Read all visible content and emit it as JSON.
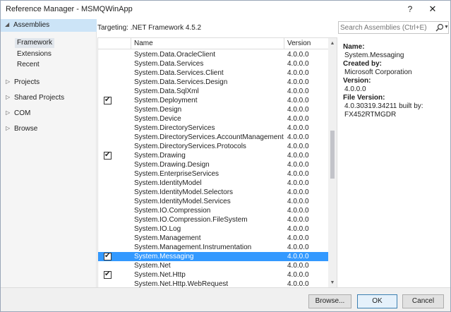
{
  "window": {
    "title": "Reference Manager - MSMQWinApp",
    "help_glyph": "?",
    "close_glyph": "✕"
  },
  "nav": {
    "header_label": "Assemblies",
    "header_arrow": "◢",
    "sub_items": [
      "Framework",
      "Extensions",
      "Recent"
    ],
    "groups": [
      {
        "label": "Projects",
        "arrow": "▷"
      },
      {
        "label": "Shared Projects",
        "arrow": "▷"
      },
      {
        "label": "COM",
        "arrow": "▷"
      },
      {
        "label": "Browse",
        "arrow": "▷"
      }
    ]
  },
  "targeting": {
    "text": "Targeting: .NET Framework 4.5.2"
  },
  "search": {
    "placeholder": "Search Assemblies (Ctrl+E)",
    "icon": "search-icon",
    "dropdown_glyph": "▼"
  },
  "grid": {
    "columns": [
      "Name",
      "Version"
    ],
    "rows": [
      {
        "name": "System.Data.OracleClient",
        "version": "4.0.0.0",
        "checked": false,
        "selected": false
      },
      {
        "name": "System.Data.Services",
        "version": "4.0.0.0",
        "checked": false,
        "selected": false
      },
      {
        "name": "System.Data.Services.Client",
        "version": "4.0.0.0",
        "checked": false,
        "selected": false
      },
      {
        "name": "System.Data.Services.Design",
        "version": "4.0.0.0",
        "checked": false,
        "selected": false
      },
      {
        "name": "System.Data.SqlXml",
        "version": "4.0.0.0",
        "checked": false,
        "selected": false
      },
      {
        "name": "System.Deployment",
        "version": "4.0.0.0",
        "checked": true,
        "selected": false
      },
      {
        "name": "System.Design",
        "version": "4.0.0.0",
        "checked": false,
        "selected": false
      },
      {
        "name": "System.Device",
        "version": "4.0.0.0",
        "checked": false,
        "selected": false
      },
      {
        "name": "System.DirectoryServices",
        "version": "4.0.0.0",
        "checked": false,
        "selected": false
      },
      {
        "name": "System.DirectoryServices.AccountManagement",
        "version": "4.0.0.0",
        "checked": false,
        "selected": false
      },
      {
        "name": "System.DirectoryServices.Protocols",
        "version": "4.0.0.0",
        "checked": false,
        "selected": false
      },
      {
        "name": "System.Drawing",
        "version": "4.0.0.0",
        "checked": true,
        "selected": false
      },
      {
        "name": "System.Drawing.Design",
        "version": "4.0.0.0",
        "checked": false,
        "selected": false
      },
      {
        "name": "System.EnterpriseServices",
        "version": "4.0.0.0",
        "checked": false,
        "selected": false
      },
      {
        "name": "System.IdentityModel",
        "version": "4.0.0.0",
        "checked": false,
        "selected": false
      },
      {
        "name": "System.IdentityModel.Selectors",
        "version": "4.0.0.0",
        "checked": false,
        "selected": false
      },
      {
        "name": "System.IdentityModel.Services",
        "version": "4.0.0.0",
        "checked": false,
        "selected": false
      },
      {
        "name": "System.IO.Compression",
        "version": "4.0.0.0",
        "checked": false,
        "selected": false
      },
      {
        "name": "System.IO.Compression.FileSystem",
        "version": "4.0.0.0",
        "checked": false,
        "selected": false
      },
      {
        "name": "System.IO.Log",
        "version": "4.0.0.0",
        "checked": false,
        "selected": false
      },
      {
        "name": "System.Management",
        "version": "4.0.0.0",
        "checked": false,
        "selected": false
      },
      {
        "name": "System.Management.Instrumentation",
        "version": "4.0.0.0",
        "checked": false,
        "selected": false
      },
      {
        "name": "System.Messaging",
        "version": "4.0.0.0",
        "checked": true,
        "selected": true
      },
      {
        "name": "System.Net",
        "version": "4.0.0.0",
        "checked": false,
        "selected": false
      },
      {
        "name": "System.Net.Http",
        "version": "4.0.0.0",
        "checked": true,
        "selected": false
      },
      {
        "name": "System.Net.Http.WebRequest",
        "version": "4.0.0.0",
        "checked": false,
        "selected": false
      }
    ],
    "check_glyph": "✔",
    "scroll_up_glyph": "▲",
    "scroll_down_glyph": "▼"
  },
  "details": {
    "name_label": "Name:",
    "name_value": "System.Messaging",
    "created_by_label": "Created by:",
    "created_by_value": "Microsoft Corporation",
    "version_label": "Version:",
    "version_value": "4.0.0.0",
    "file_version_label": "File Version:",
    "file_version_line1": "4.0.30319.34211 built by:",
    "file_version_line2": "FX452RTMGDR"
  },
  "footer": {
    "browse_label": "Browse...",
    "ok_label": "OK",
    "cancel_label": "Cancel"
  }
}
